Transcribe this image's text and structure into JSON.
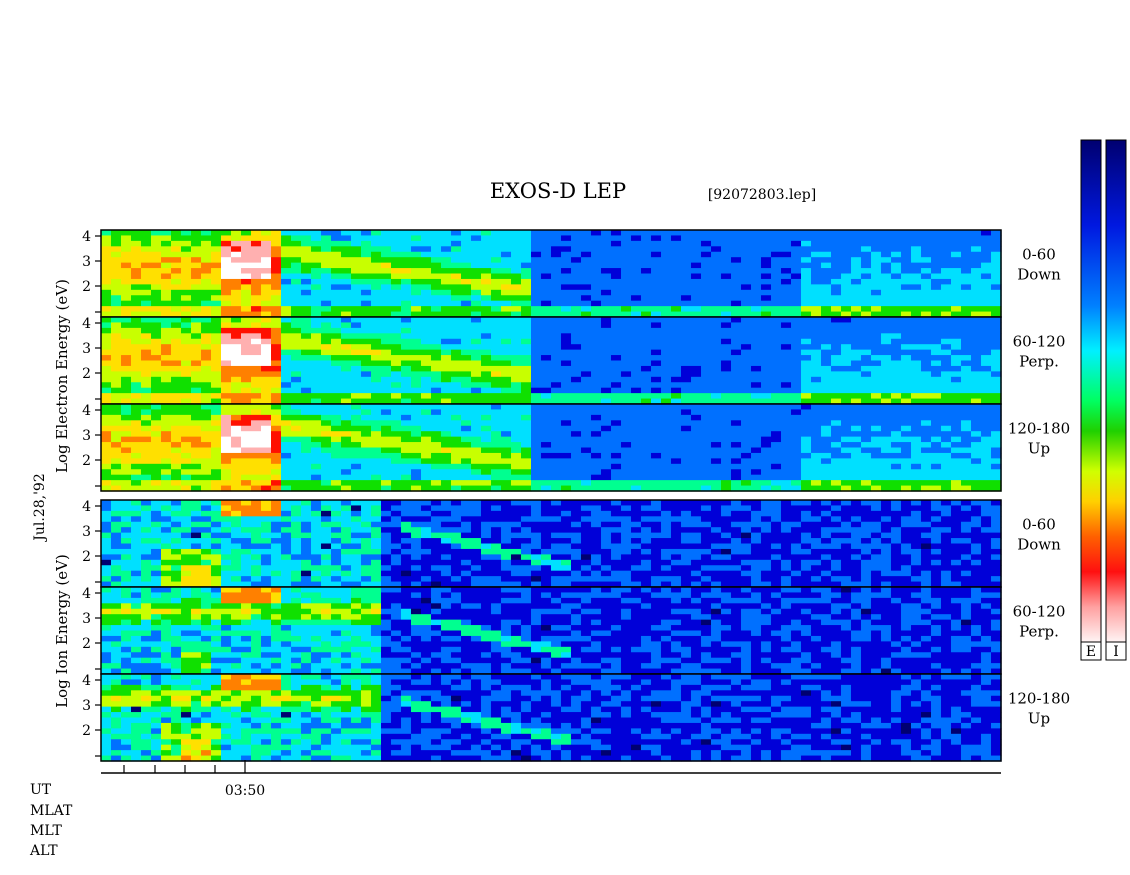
{
  "chart_data": {
    "type": "heatmap",
    "title": "EXOS-D LEP",
    "file_label": "[92072803.lep]",
    "date_label": "Jul.28,'92",
    "x_axis": {
      "tick_label": "03:50",
      "row_labels": [
        "UT",
        "MLAT",
        "MLT",
        "ALT"
      ]
    },
    "y_ticks": [
      "1",
      "2",
      "3",
      "4"
    ],
    "groups": [
      {
        "id": "electron",
        "ylabel": "Log  Electron  Energy (eV)",
        "panels": [
          {
            "label": [
              "0-60",
              "Down"
            ]
          },
          {
            "label": [
              "60-120",
              "Perp."
            ]
          },
          {
            "label": [
              "120-180",
              "Up"
            ]
          }
        ]
      },
      {
        "id": "ion",
        "ylabel": "Log  Ion  Energy (eV)",
        "panels": [
          {
            "label": [
              "0-60",
              "Down"
            ]
          },
          {
            "label": [
              "60-120",
              "Perp."
            ]
          },
          {
            "label": [
              "120-180",
              "Up"
            ]
          }
        ]
      }
    ],
    "colorbars": [
      {
        "label": "E"
      },
      {
        "label": "I"
      }
    ],
    "colormap": [
      "#000070",
      "#0000d8",
      "#0070ff",
      "#00e0ff",
      "#00ff90",
      "#10e000",
      "#c8ff00",
      "#ffe000",
      "#ff8000",
      "#ff1000",
      "#ffb0b0",
      "#ffffff"
    ]
  }
}
